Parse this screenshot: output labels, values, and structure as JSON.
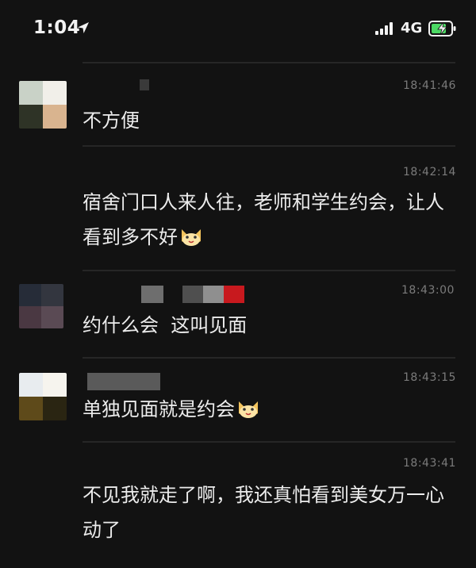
{
  "status": {
    "time": "1:04",
    "network": "4G"
  },
  "messages": [
    {
      "timestamp": "18:41:46",
      "text": "不方便",
      "emoji": false
    },
    {
      "timestamp": "18:42:14",
      "text": "宿舍门口人来人往，老师和学生约会，让人看到多不好",
      "emoji": true
    },
    {
      "timestamp": "18:43:00",
      "text": "约什么会  这叫见面",
      "emoji": false
    },
    {
      "timestamp": "18:43:15",
      "text": "单独见面就是约会",
      "emoji": true
    },
    {
      "timestamp": "18:43:41",
      "text": "不见我就走了啊，我还真怕看到美女万一心动了",
      "emoji": false
    }
  ],
  "colors": {
    "background": "#121212",
    "text": "#ececec",
    "timestamp": "#7b7b7b",
    "battery_green": "#4cd964",
    "redaction_red": "#c8191e"
  },
  "icons": [
    "location-arrow-icon",
    "signal-bars-icon",
    "battery-charging-icon",
    "cat-face-emoji"
  ]
}
